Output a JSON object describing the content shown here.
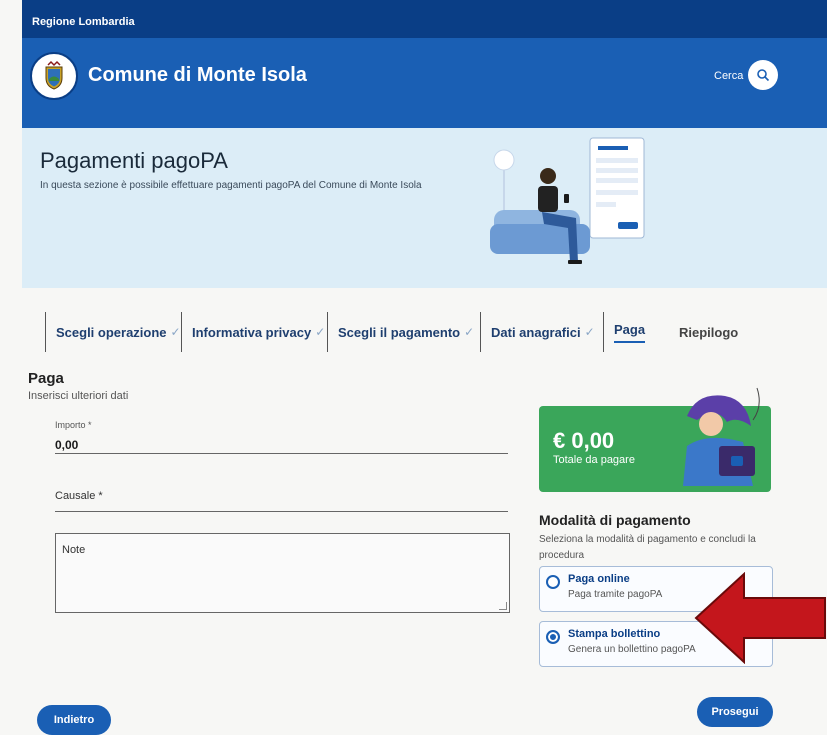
{
  "topbar": {
    "region": "Regione Lombardia"
  },
  "header": {
    "title": "Comune di Monte Isola",
    "search_label": "Cerca"
  },
  "hero": {
    "title": "Pagamenti pagoPA",
    "subtitle": "In questa sezione è possibile effettuare pagamenti pagoPA del Comune di Monte Isola"
  },
  "steps": [
    {
      "label": "Scegli operazione",
      "check": "✓"
    },
    {
      "label": "Informativa privacy",
      "check": "✓"
    },
    {
      "label": "Scegli il pagamento",
      "check": "✓"
    },
    {
      "label": "Dati anagrafici",
      "check": "✓"
    },
    {
      "label": "Paga"
    },
    {
      "label": "Riepilogo"
    }
  ],
  "form": {
    "title": "Paga",
    "subtitle": "Inserisci ulteriori dati",
    "importo_label": "Importo *",
    "importo_value": "0,00",
    "causale_label": "Causale *",
    "note_placeholder": "Note"
  },
  "total": {
    "amount": "€ 0,00",
    "label": "Totale da pagare"
  },
  "payment": {
    "title": "Modalità di pagamento",
    "description": "Seleziona la modalità di pagamento e concludi la procedura",
    "options": [
      {
        "title": "Paga online",
        "subtitle": "Paga tramite pagoPA",
        "selected": false
      },
      {
        "title": "Stampa bollettino",
        "subtitle": "Genera un bollettino pagoPA",
        "selected": true
      }
    ]
  },
  "buttons": {
    "back": "Indietro",
    "next": "Prosegui"
  },
  "colors": {
    "primary": "#1a5fb4",
    "dark_blue": "#0a3e86",
    "hero_bg": "#dcedf7",
    "total_green": "#3aa65a",
    "arrow_red": "#c4161c"
  }
}
